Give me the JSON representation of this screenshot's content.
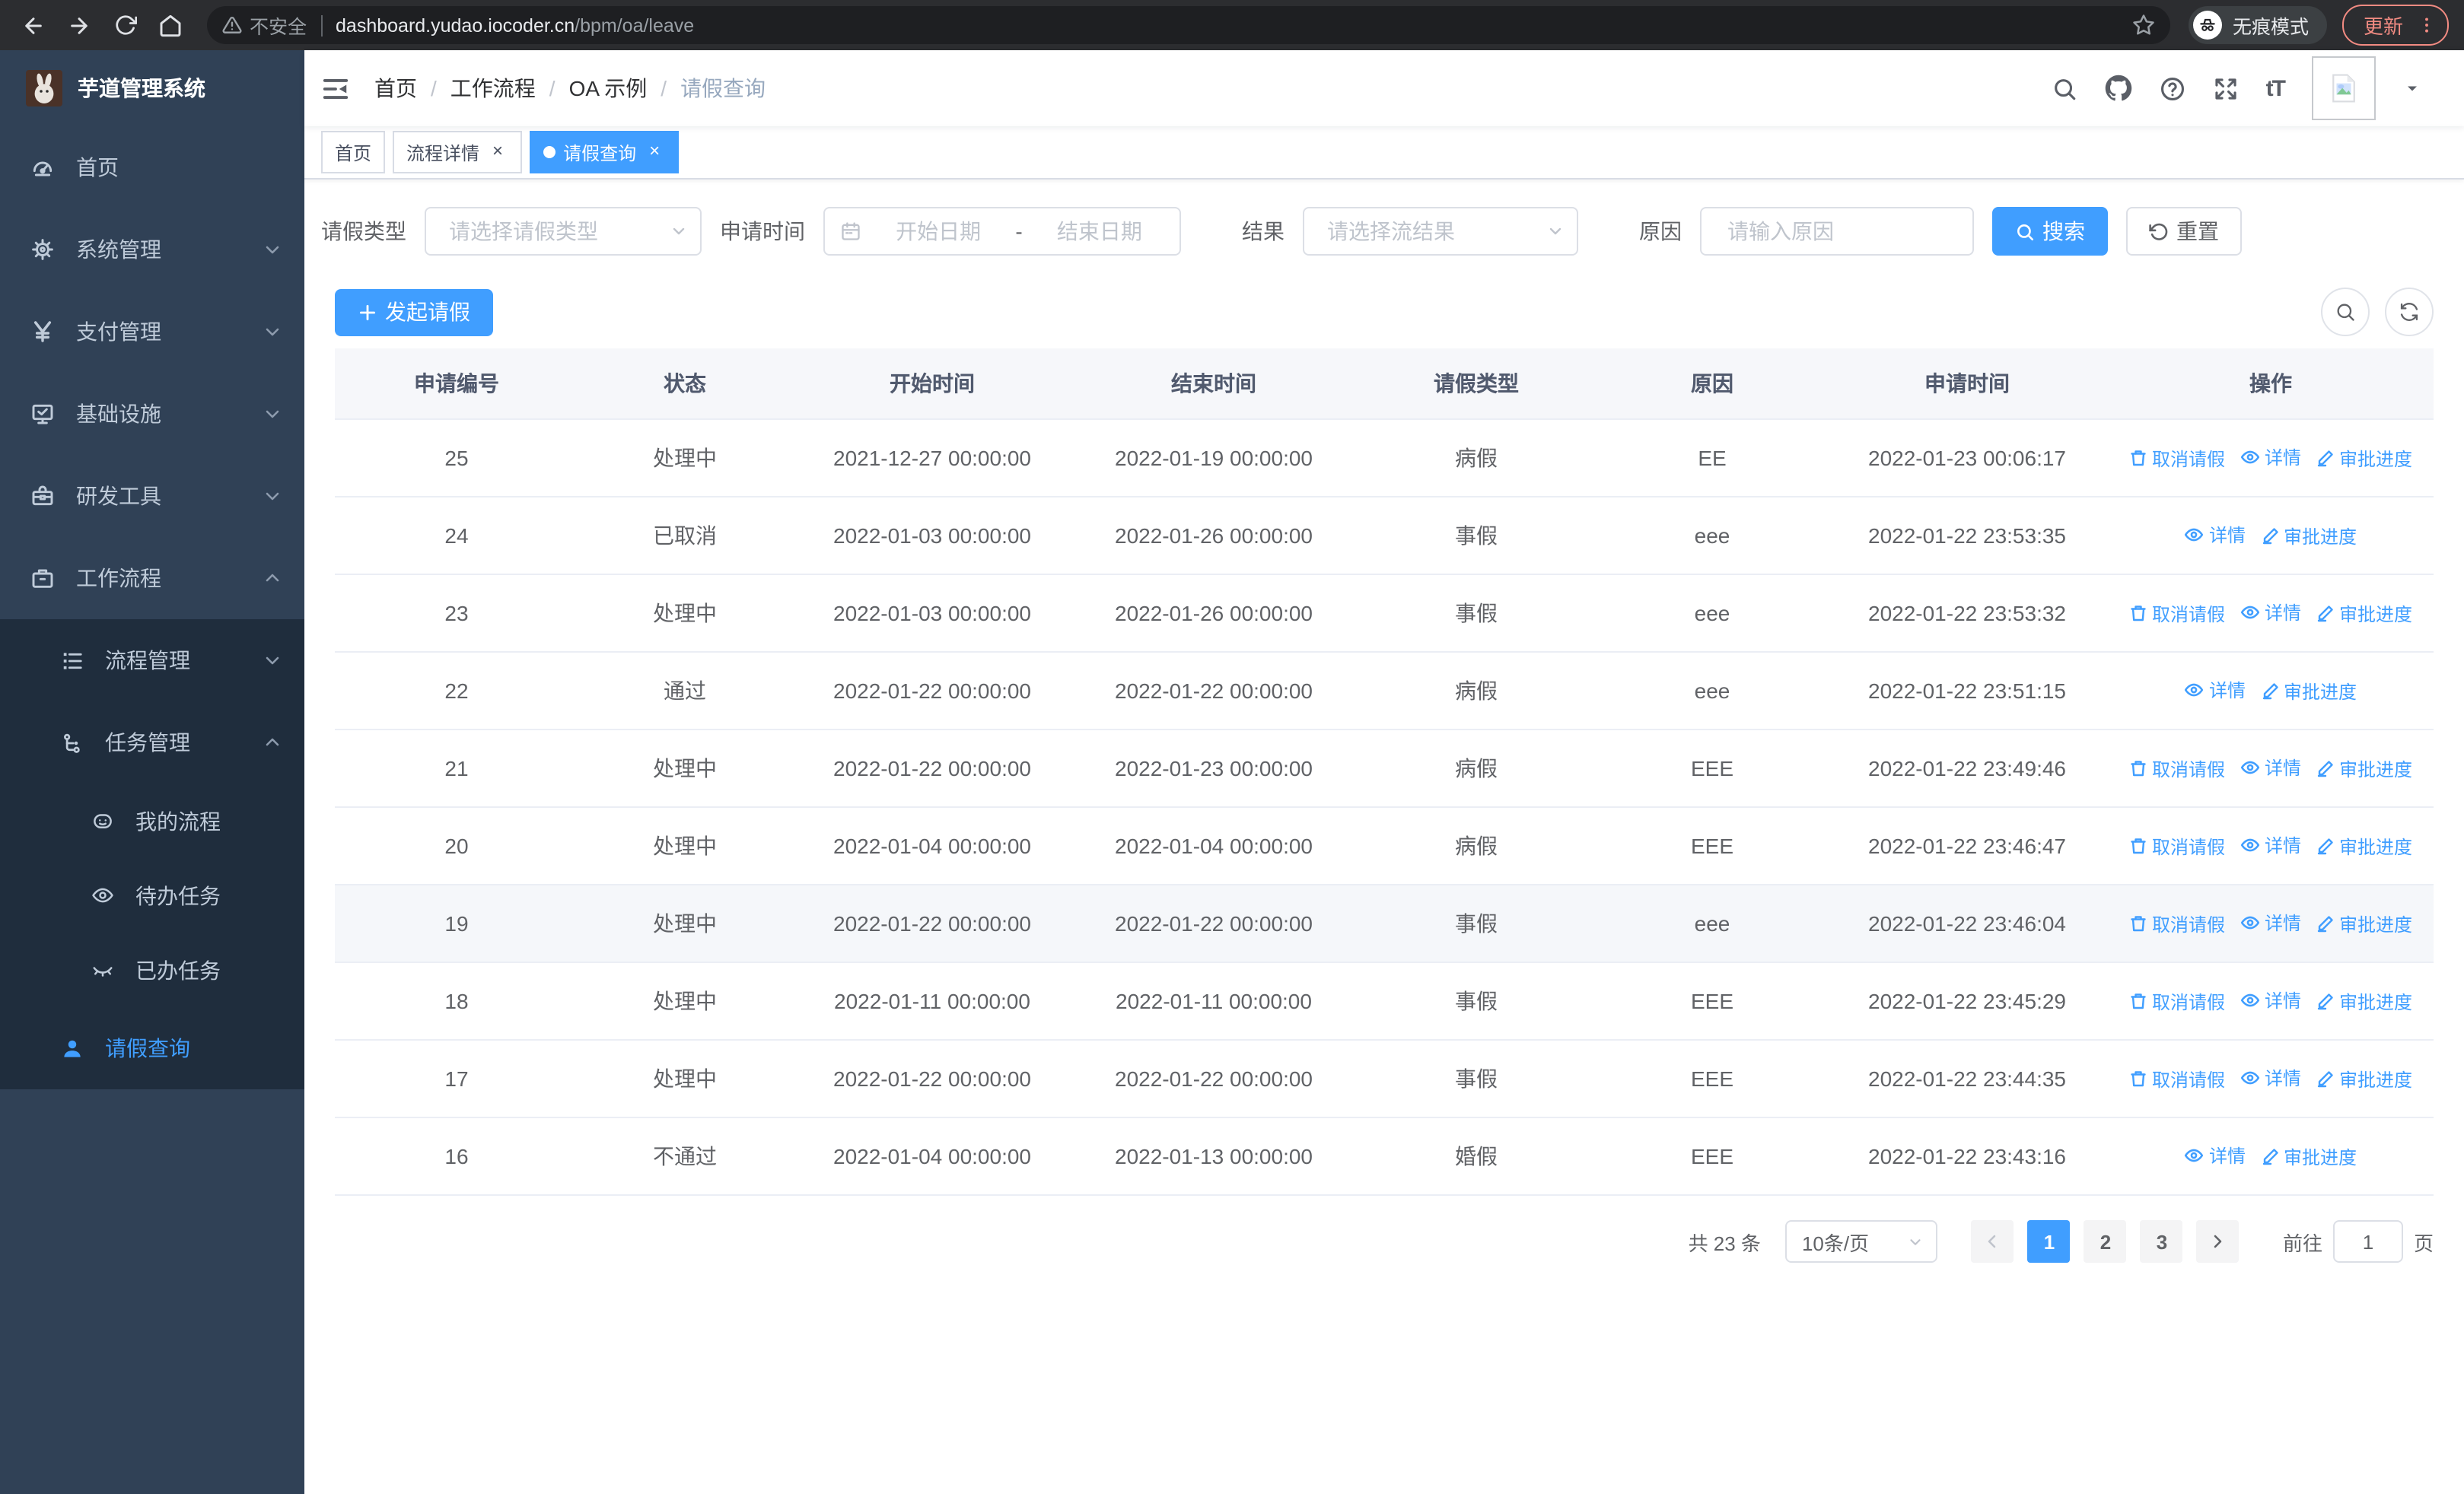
{
  "browser": {
    "security": "不安全",
    "host": "dashboard.yudao.iocoder.cn",
    "path": "/bpm/oa/leave",
    "incognito": "无痕模式",
    "update": "更新"
  },
  "colors": {
    "accent": "#409eff",
    "sidebar_bg": "#304156",
    "sidebar_submenu_bg": "#1f2d3d",
    "sidebar_text": "#bfcbd9",
    "update_chip": "#f28b82",
    "table_border": "#ebeef5",
    "highlight_row": "#f5f7fa"
  },
  "icons": [
    "back-icon",
    "forward-icon",
    "reload-icon",
    "home-icon",
    "warning-icon",
    "bookmark-star-icon",
    "incognito-icon",
    "kebab-menu-icon",
    "dashboard-icon",
    "gear-icon",
    "yen-icon",
    "monitor-icon",
    "toolbox-icon",
    "briefcase-icon",
    "list-tree-icon",
    "org-tree-icon",
    "robot-icon",
    "eye-icon",
    "eye-closed-icon",
    "person-icon",
    "fold-icon",
    "search-icon",
    "github-icon",
    "help-icon",
    "fullscreen-icon",
    "font-size-icon",
    "image-placeholder-icon",
    "caret-down-icon",
    "chevron-down-icon",
    "chevron-up-icon",
    "calendar-icon",
    "plus-icon",
    "refresh-icon",
    "trash-icon",
    "edit-pen-icon",
    "chevron-left-icon",
    "chevron-right-icon"
  ],
  "sidebar": {
    "title": "芋道管理系统",
    "items": [
      {
        "label": "首页"
      },
      {
        "label": "系统管理"
      },
      {
        "label": "支付管理"
      },
      {
        "label": "基础设施"
      },
      {
        "label": "研发工具"
      },
      {
        "label": "工作流程"
      },
      {
        "label": "流程管理"
      },
      {
        "label": "任务管理"
      },
      {
        "label": "我的流程"
      },
      {
        "label": "待办任务"
      },
      {
        "label": "已办任务"
      },
      {
        "label": "请假查询"
      }
    ]
  },
  "breadcrumb": {
    "separator": "/",
    "items": [
      "首页",
      "工作流程",
      "OA 示例",
      "请假查询"
    ]
  },
  "tabs": [
    {
      "label": "首页",
      "closable": false,
      "active": false
    },
    {
      "label": "流程详情",
      "closable": true,
      "active": false
    },
    {
      "label": "请假查询",
      "closable": true,
      "active": true
    }
  ],
  "filters": {
    "leave_type_label": "请假类型",
    "leave_type_placeholder": "请选择请假类型",
    "apply_time_label": "申请时间",
    "date_start_placeholder": "开始日期",
    "date_separator": "-",
    "date_end_placeholder": "结束日期",
    "result_label": "结果",
    "result_placeholder": "请选择流结果",
    "reason_label": "原因",
    "reason_placeholder": "请输入原因",
    "search_label": "搜索",
    "reset_label": "重置"
  },
  "toolbar": {
    "create_label": "发起请假"
  },
  "table": {
    "columns": [
      "申请编号",
      "状态",
      "开始时间",
      "结束时间",
      "请假类型",
      "原因",
      "申请时间",
      "操作"
    ],
    "action_labels": {
      "cancel": "取消请假",
      "detail": "详情",
      "progress": "审批进度"
    },
    "rows": [
      {
        "id": "25",
        "status": "处理中",
        "start": "2021-12-27 00:00:00",
        "end": "2022-01-19 00:00:00",
        "type": "病假",
        "reason": "EE",
        "apply_time": "2022-01-23 00:06:17",
        "actions": [
          "cancel",
          "detail",
          "progress"
        ],
        "highlighted": false
      },
      {
        "id": "24",
        "status": "已取消",
        "start": "2022-01-03 00:00:00",
        "end": "2022-01-26 00:00:00",
        "type": "事假",
        "reason": "eee",
        "apply_time": "2022-01-22 23:53:35",
        "actions": [
          "detail",
          "progress"
        ],
        "highlighted": false
      },
      {
        "id": "23",
        "status": "处理中",
        "start": "2022-01-03 00:00:00",
        "end": "2022-01-26 00:00:00",
        "type": "事假",
        "reason": "eee",
        "apply_time": "2022-01-22 23:53:32",
        "actions": [
          "cancel",
          "detail",
          "progress"
        ],
        "highlighted": false
      },
      {
        "id": "22",
        "status": "通过",
        "start": "2022-01-22 00:00:00",
        "end": "2022-01-22 00:00:00",
        "type": "病假",
        "reason": "eee",
        "apply_time": "2022-01-22 23:51:15",
        "actions": [
          "detail",
          "progress"
        ],
        "highlighted": false
      },
      {
        "id": "21",
        "status": "处理中",
        "start": "2022-01-22 00:00:00",
        "end": "2022-01-23 00:00:00",
        "type": "病假",
        "reason": "EEE",
        "apply_time": "2022-01-22 23:49:46",
        "actions": [
          "cancel",
          "detail",
          "progress"
        ],
        "highlighted": false
      },
      {
        "id": "20",
        "status": "处理中",
        "start": "2022-01-04 00:00:00",
        "end": "2022-01-04 00:00:00",
        "type": "病假",
        "reason": "EEE",
        "apply_time": "2022-01-22 23:46:47",
        "actions": [
          "cancel",
          "detail",
          "progress"
        ],
        "highlighted": false
      },
      {
        "id": "19",
        "status": "处理中",
        "start": "2022-01-22 00:00:00",
        "end": "2022-01-22 00:00:00",
        "type": "事假",
        "reason": "eee",
        "apply_time": "2022-01-22 23:46:04",
        "actions": [
          "cancel",
          "detail",
          "progress"
        ],
        "highlighted": true
      },
      {
        "id": "18",
        "status": "处理中",
        "start": "2022-01-11 00:00:00",
        "end": "2022-01-11 00:00:00",
        "type": "事假",
        "reason": "EEE",
        "apply_time": "2022-01-22 23:45:29",
        "actions": [
          "cancel",
          "detail",
          "progress"
        ],
        "highlighted": false
      },
      {
        "id": "17",
        "status": "处理中",
        "start": "2022-01-22 00:00:00",
        "end": "2022-01-22 00:00:00",
        "type": "事假",
        "reason": "EEE",
        "apply_time": "2022-01-22 23:44:35",
        "actions": [
          "cancel",
          "detail",
          "progress"
        ],
        "highlighted": false
      },
      {
        "id": "16",
        "status": "不通过",
        "start": "2022-01-04 00:00:00",
        "end": "2022-01-13 00:00:00",
        "type": "婚假",
        "reason": "EEE",
        "apply_time": "2022-01-22 23:43:16",
        "actions": [
          "detail",
          "progress"
        ],
        "highlighted": false
      }
    ]
  },
  "pagination": {
    "total": "共 23 条",
    "page_size": "10条/页",
    "prev_disabled": true,
    "pages": [
      "1",
      "2",
      "3"
    ],
    "current": "1",
    "goto_label": "前往",
    "goto_value": "1",
    "goto_unit": "页"
  }
}
